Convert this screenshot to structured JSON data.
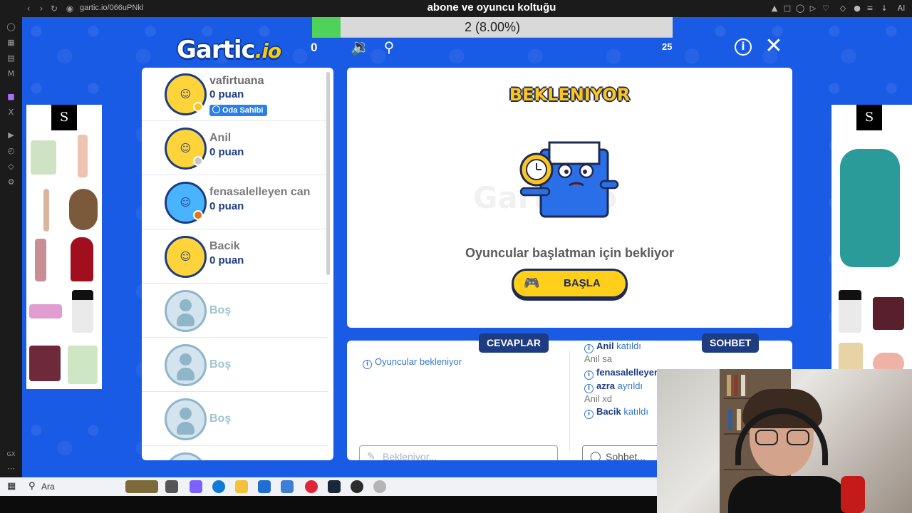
{
  "browser": {
    "url": "gartic.io/066uPNkl",
    "stream_title": "abone ve oyuncu koltuğu",
    "gx_label": "GX"
  },
  "progress": {
    "text": "2 (8.00%)",
    "fraction": 0.08
  },
  "header": {
    "logo_main": "Gartic",
    "logo_io": ".io",
    "left_count": "0",
    "right_count": "25"
  },
  "players": [
    {
      "name": "vafirtuana",
      "score": "0 puan",
      "badge": "Oda Sahibi",
      "status_color": "#ffc61a",
      "avatar_style": "yellow"
    },
    {
      "name": "Anil",
      "score": "0 puan",
      "status_color": "#c9c9c9",
      "avatar_style": "hat"
    },
    {
      "name": "fenasalelleyen can",
      "score": "0 puan",
      "status_color": "#e0761c",
      "avatar_style": "blue"
    },
    {
      "name": "Bacik",
      "score": "0 puan",
      "avatar_style": "yellow"
    },
    {
      "name": "Boş"
    },
    {
      "name": "Boş"
    },
    {
      "name": "Boş"
    }
  ],
  "main": {
    "title": "BEKLENIYOR",
    "watermark": "Gartic.io",
    "subtitle": "Oyuncular başlatman için bekliyor",
    "start_label": "BAŞLA"
  },
  "answers": {
    "tab": "CEVAPLAR",
    "message": "Oyuncular bekleniyor",
    "input_placeholder": "Bekleniyor..."
  },
  "chat": {
    "tab": "SOHBET",
    "input_placeholder": "Sohbet...",
    "lines": [
      {
        "type": "sys",
        "bold": "Anil",
        "text": " katıldı"
      },
      {
        "type": "usr",
        "user": "Anil",
        "text": " sa"
      },
      {
        "type": "sys",
        "bold": "fenasalelleyen c",
        "text": ""
      },
      {
        "type": "sys",
        "bold": "azra",
        "text": " ayrıldı"
      },
      {
        "type": "usr",
        "user": "Anil",
        "text": " xd"
      },
      {
        "type": "sys",
        "bold": "Bacik",
        "text": " katıldı"
      }
    ]
  },
  "taskbar": {
    "search_label": "Ara"
  },
  "colors": {
    "game_bg": "#1a5be6",
    "navy": "#1d3c82",
    "accent_yellow": "#ffcf1a",
    "progress_green": "#4fd25a"
  }
}
